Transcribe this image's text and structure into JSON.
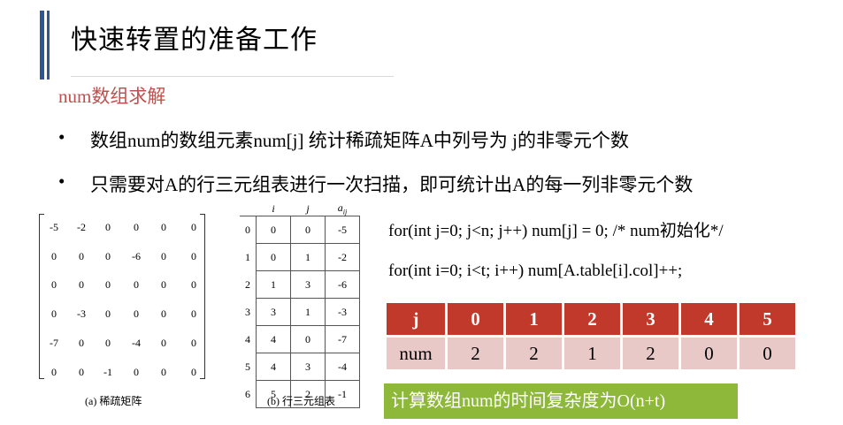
{
  "slide": {
    "title": "快速转置的准备工作",
    "subtitle": "num数组求解",
    "bullets": [
      {
        "dot": "•",
        "text": "数组num的数组元素num[j] 统计稀疏矩阵A中列号为 j的非零元个数"
      },
      {
        "dot": "•",
        "text": "只需要对A的行三元组表进行一次扫描，即可统计出A的每一列非零元个数"
      }
    ]
  },
  "matrix": {
    "caption": "(a) 稀疏矩阵",
    "rows": [
      [
        "-5",
        "-2",
        "0",
        "0",
        "0",
        "0"
      ],
      [
        "0",
        "0",
        "0",
        "-6",
        "0",
        "0"
      ],
      [
        "0",
        "0",
        "0",
        "0",
        "0",
        "0"
      ],
      [
        "0",
        "-3",
        "0",
        "0",
        "0",
        "0"
      ],
      [
        "-7",
        "0",
        "0",
        "-4",
        "0",
        "0"
      ],
      [
        "0",
        "0",
        "-1",
        "0",
        "0",
        "0"
      ]
    ]
  },
  "triple": {
    "caption": "(b) 行三元组表",
    "headers": [
      "i",
      "j",
      "aij"
    ],
    "rows": [
      {
        "idx": "0",
        "i": "0",
        "j": "0",
        "v": "-5"
      },
      {
        "idx": "1",
        "i": "0",
        "j": "1",
        "v": "-2"
      },
      {
        "idx": "2",
        "i": "1",
        "j": "3",
        "v": "-6"
      },
      {
        "idx": "3",
        "i": "3",
        "j": "1",
        "v": "-3"
      },
      {
        "idx": "4",
        "i": "4",
        "j": "0",
        "v": "-7"
      },
      {
        "idx": "5",
        "i": "4",
        "j": "3",
        "v": "-4"
      },
      {
        "idx": "6",
        "i": "5",
        "j": "2",
        "v": "-1"
      }
    ]
  },
  "code": {
    "line1": "for(int j=0; j<n; j++) num[j] = 0;  /* num初始化*/",
    "line2": "for(int i=0; i<t; i++) num[A.table[i].col]++;"
  },
  "num_table": {
    "header": [
      "j",
      "0",
      "1",
      "2",
      "3",
      "4",
      "5"
    ],
    "row": [
      "num",
      "2",
      "2",
      "1",
      "2",
      "0",
      "0"
    ],
    "header_color": "#c0392b",
    "row_color": "#e8c9c8"
  },
  "result": {
    "text": "计算数组num的时间复杂度为O(n+t)",
    "color": "#8db83a"
  }
}
